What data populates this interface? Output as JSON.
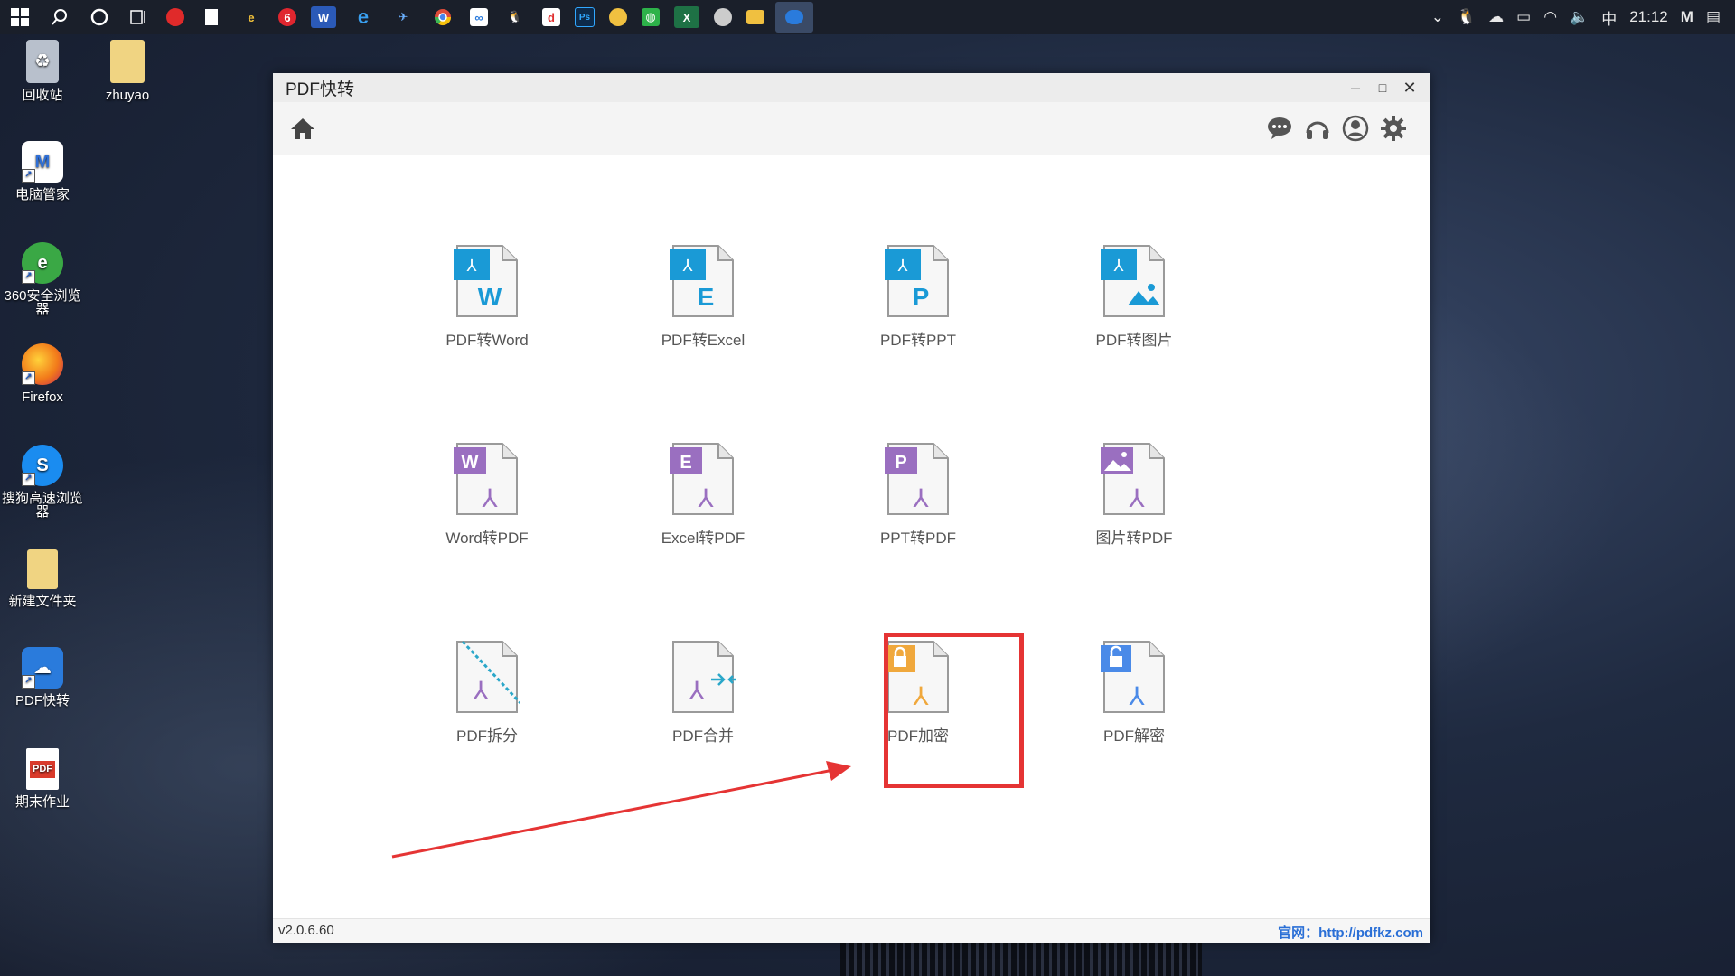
{
  "taskbar": {
    "clock": "21:12",
    "ime": "中",
    "icons": [
      "windows-start-icon",
      "search-icon",
      "cortana-icon",
      "task-view-icon",
      "netease-music-icon",
      "notepad-icon",
      "ie-colorful-icon",
      "netease-cloud-icon",
      "word-icon",
      "edge-icon",
      "live-icon",
      "chrome-icon",
      "baidu-netdisk-icon",
      "qq-icon",
      "app-icon",
      "photoshop-icon",
      "emoji-app-icon",
      "wechat-icon",
      "excel-icon",
      "browser-icon",
      "file-explorer-icon",
      "pdf-kuaizhuan-icon"
    ]
  },
  "desktop": {
    "icons": [
      {
        "label": "回收站",
        "name": "recycle-bin-icon",
        "color": "#9aa5b5"
      },
      {
        "label": "zhuyao",
        "name": "folder-zip-icon",
        "color": "#e8c15a"
      },
      {
        "label": "电脑管家",
        "name": "pc-manager-icon",
        "color": "#2f6fd6"
      },
      {
        "label": "360安全浏览器",
        "name": "browser-360-icon",
        "color": "#3aa845"
      },
      {
        "label": "Firefox",
        "name": "firefox-icon",
        "color": "#f27a1a"
      },
      {
        "label": "搜狗高速浏览器",
        "name": "sogou-browser-icon",
        "color": "#1a8cf0"
      },
      {
        "label": "新建文件夹",
        "name": "new-folder-icon",
        "color": "#e8c15a"
      },
      {
        "label": "PDF快转",
        "name": "pdf-kuaizhuan-desktop-icon",
        "color": "#2a7bdc"
      },
      {
        "label": "期末作业",
        "name": "pdf-file-icon",
        "color": "#d93a2b"
      }
    ]
  },
  "window": {
    "title": "PDF快转",
    "version": "v2.0.6.60",
    "website": "官网：http://pdfkz.com"
  },
  "tiles": [
    {
      "label": "PDF转Word",
      "name": "pdf-to-word-tile",
      "badge": "W",
      "scheme": "pdf-to"
    },
    {
      "label": "PDF转Excel",
      "name": "pdf-to-excel-tile",
      "badge": "E",
      "scheme": "pdf-to"
    },
    {
      "label": "PDF转PPT",
      "name": "pdf-to-ppt-tile",
      "badge": "P",
      "scheme": "pdf-to"
    },
    {
      "label": "PDF转图片",
      "name": "pdf-to-image-tile",
      "badge": "img",
      "scheme": "pdf-to"
    },
    {
      "label": "Word转PDF",
      "name": "word-to-pdf-tile",
      "badge": "W",
      "scheme": "to-pdf"
    },
    {
      "label": "Excel转PDF",
      "name": "excel-to-pdf-tile",
      "badge": "E",
      "scheme": "to-pdf"
    },
    {
      "label": "PPT转PDF",
      "name": "ppt-to-pdf-tile",
      "badge": "P",
      "scheme": "to-pdf"
    },
    {
      "label": "图片转PDF",
      "name": "image-to-pdf-tile",
      "badge": "img",
      "scheme": "to-pdf"
    },
    {
      "label": "PDF拆分",
      "name": "pdf-split-tile",
      "badge": "split",
      "scheme": "tool"
    },
    {
      "label": "PDF合并",
      "name": "pdf-merge-tile",
      "badge": "merge",
      "scheme": "tool"
    },
    {
      "label": "PDF加密",
      "name": "pdf-encrypt-tile",
      "badge": "lock",
      "scheme": "lock"
    },
    {
      "label": "PDF解密",
      "name": "pdf-decrypt-tile",
      "badge": "unlock",
      "scheme": "unlock"
    }
  ],
  "colors": {
    "pdfToBlue": "#1a9ad6",
    "toPdfPurple": "#9a6fc0",
    "lockOrange": "#f0a83c",
    "unlockBlue": "#4a8ae8",
    "highlightRed": "#e53434"
  }
}
